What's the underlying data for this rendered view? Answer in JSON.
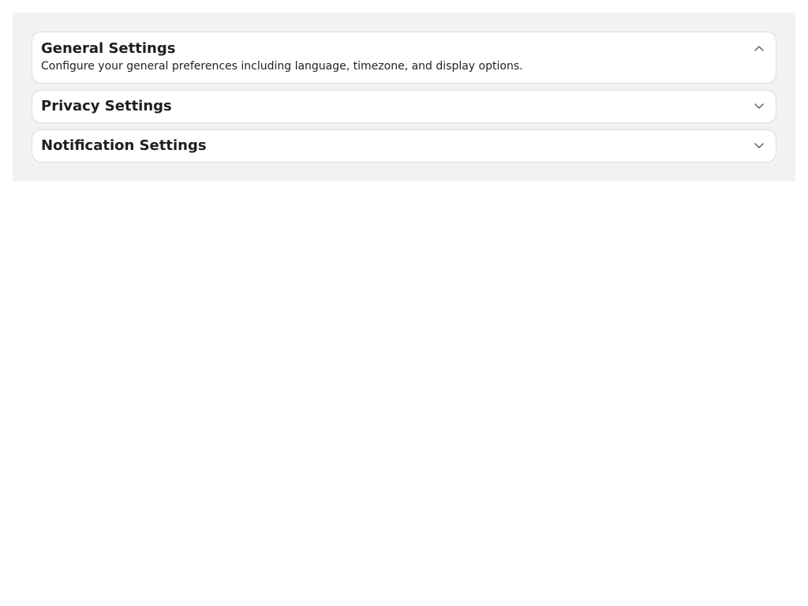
{
  "accordion": {
    "items": [
      {
        "title": "General Settings",
        "description": "Configure your general preferences including language, timezone, and display options.",
        "expanded": true
      },
      {
        "title": "Privacy Settings",
        "expanded": false
      },
      {
        "title": "Notification Settings",
        "expanded": false
      }
    ]
  },
  "colors": {
    "panel_background": "#f2f2f4",
    "card_background": "#ffffff",
    "card_border": "#dcdce0",
    "text": "#1f1f1f",
    "chevron": "#555555"
  },
  "icons": {
    "expanded": "chevron-up-icon",
    "collapsed": "chevron-down-icon"
  }
}
